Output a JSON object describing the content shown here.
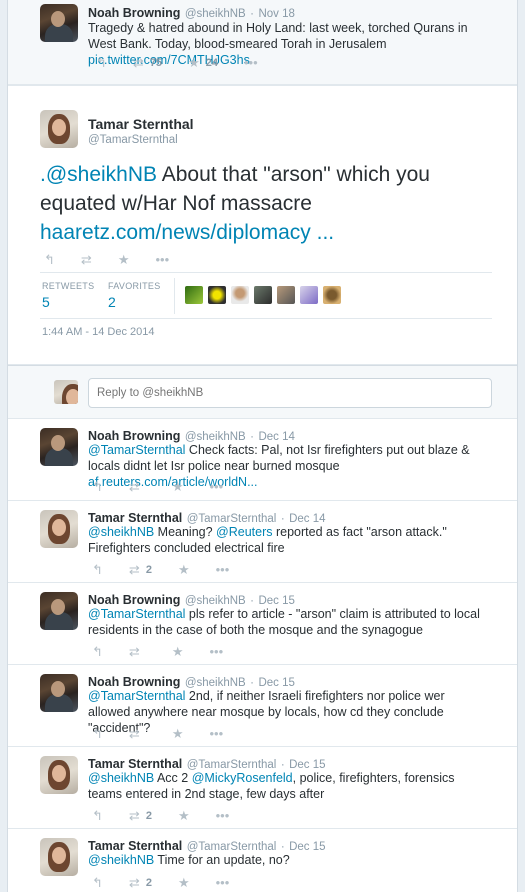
{
  "top_tweet": {
    "name": "Noah Browning",
    "handle": "@sheikhNB",
    "time": "Nov 18",
    "text": "Tragedy & hatred abound in Holy Land: last week, torched Qurans in West Bank. Today, blood-smeared Torah in Jerusalem",
    "link": "pic.twitter.com/7CMTHJG3hs",
    "retweets": "75",
    "favorites": "24"
  },
  "main_tweet": {
    "name": "Tamar Sternthal",
    "handle": "@TamarSternthal",
    "text_mention": ".@sheikhNB",
    "text_rest": " About that \"arson\" which you equated w/Har Nof massacre",
    "link": "haaretz.com/news/diplomacy ...",
    "retweets_label": "RETWEETS",
    "retweets": "5",
    "favorites_label": "FAVORITES",
    "favorites": "2",
    "timestamp": "1:44 AM - 14 Dec 2014"
  },
  "reply_box": {
    "placeholder": "Reply to @sheikhNB"
  },
  "replies": [
    {
      "name": "Noah Browning",
      "handle": "@sheikhNB",
      "time": "Dec 14",
      "mention": "@TamarSternthal",
      "text": " Check facts: Pal, not Isr firefighters put out blaze & locals didnt let Isr police near burned mosque ",
      "link": "af.reuters.com/article/worldN...",
      "retweets": ""
    },
    {
      "name": "Tamar Sternthal",
      "handle": "@TamarSternthal",
      "time": "Dec 14",
      "mention": "@sheikhNB",
      "text": " Meaning? ",
      "mention2": "@Reuters",
      "text2": " reported as fact \"arson attack.\" Firefighters concluded electrical fire",
      "retweets": "2"
    },
    {
      "name": "Noah Browning",
      "handle": "@sheikhNB",
      "time": "Dec 15",
      "mention": "@TamarSternthal",
      "text": " pls refer to article - \"arson\" claim is attributed to local residents in the case of both the mosque and the synagogue",
      "retweets": ""
    },
    {
      "name": "Noah Browning",
      "handle": "@sheikhNB",
      "time": "Dec 15",
      "mention": "@TamarSternthal",
      "text": " 2nd, if neither Israeli firefighters nor police wer allowed anywhere near mosque by locals, how cd they conclude \"accident\"?",
      "retweets": ""
    },
    {
      "name": "Tamar Sternthal",
      "handle": "@TamarSternthal",
      "time": "Dec 15",
      "mention": "@sheikhNB",
      "text": " Acc 2 ",
      "mention2": "@MickyRosenfeld",
      "text2": ", police, firefighters, forensics teams entered in 2nd stage, few days after",
      "retweets": "2"
    },
    {
      "name": "Tamar Sternthal",
      "handle": "@TamarSternthal",
      "time": "Dec 15",
      "mention": "@sheikhNB",
      "text": " Time for an update, no?",
      "retweets": "2"
    }
  ],
  "icons": {
    "reply": "reply-icon",
    "retweet": "retweet-icon",
    "favorite": "star-icon",
    "more": "more-icon"
  }
}
